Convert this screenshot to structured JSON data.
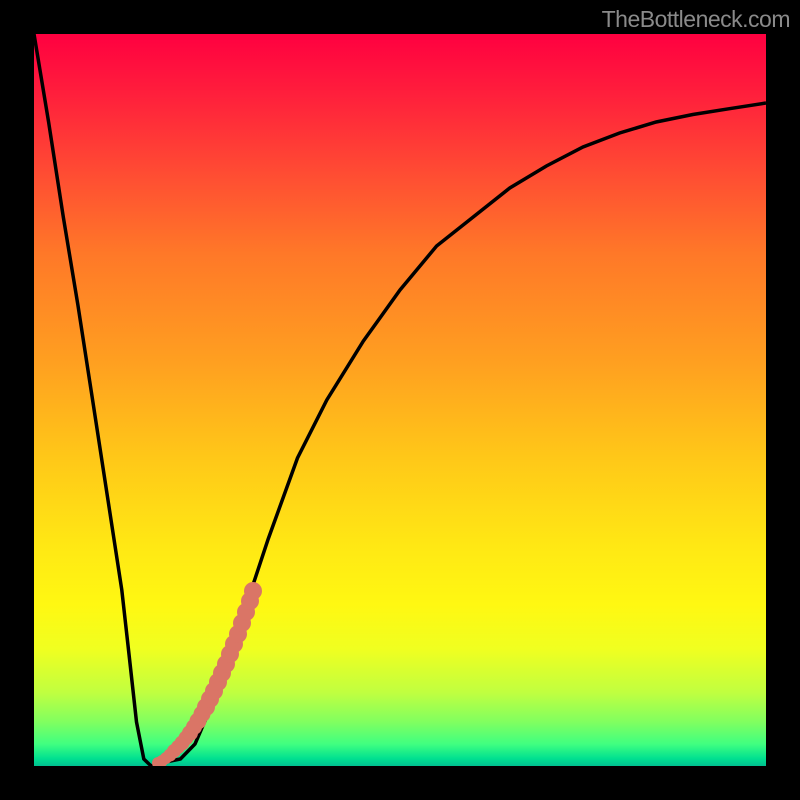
{
  "watermark": "TheBottleneck.com",
  "chart_data": {
    "type": "line",
    "title": "",
    "xlabel": "",
    "ylabel": "",
    "xlim": [
      0,
      100
    ],
    "ylim": [
      0,
      100
    ],
    "background": "gradient_red_to_green_vertical",
    "series": [
      {
        "name": "curve",
        "color": "#000000",
        "x": [
          0,
          2,
          4,
          6,
          8,
          10,
          12,
          13,
          14,
          15,
          16,
          18,
          20,
          22,
          25,
          28,
          32,
          36,
          40,
          45,
          50,
          55,
          60,
          65,
          70,
          75,
          80,
          85,
          90,
          95,
          100
        ],
        "y": [
          100,
          88,
          75,
          63,
          50,
          37,
          24,
          15,
          6,
          1,
          0,
          0.5,
          1,
          3,
          10,
          19,
          31,
          42,
          50,
          58,
          65,
          71,
          75,
          79,
          82,
          84.5,
          86.5,
          88,
          89,
          89.8,
          90.5
        ]
      },
      {
        "name": "marker_band",
        "type": "scatter",
        "color": "#d87a6e",
        "x_range": [
          17,
          29
        ],
        "y_range": [
          1,
          26
        ],
        "description": "thick segment of overlapping pink markers along ascending part of curve near bottom"
      }
    ],
    "annotations": []
  }
}
